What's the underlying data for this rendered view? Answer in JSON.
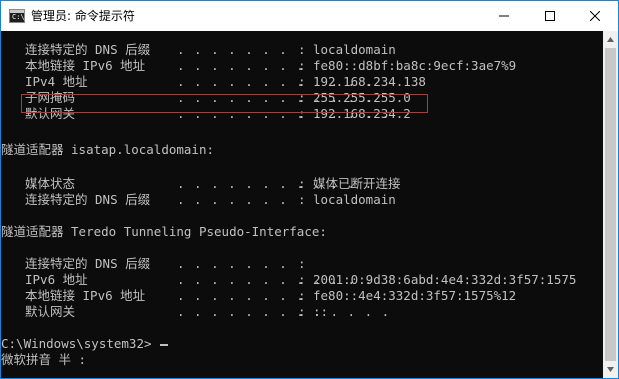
{
  "window": {
    "title": "管理员: 命令提示符",
    "icon": "cmd-icon",
    "icon_prompt": "C:\\",
    "controls": [
      "minimize-icon",
      "maximize-icon",
      "close-icon"
    ]
  },
  "colors": {
    "console_bg": "#0c0c0c",
    "console_text": "#c0c0c0",
    "highlight_border": "#d42b2b",
    "window_border": "#1883d7"
  },
  "console": {
    "lines": [
      {
        "label": "连接特定的 DNS 后缀",
        "dots": ". . . . . . .",
        "colon": ":",
        "value": "localdomain"
      },
      {
        "label": "本地链接 IPv6 地址",
        "dots": ". . . . . . . .",
        "colon": ":",
        "value": "fe80::d8bf:ba8c:9ecf:3ae7%9"
      },
      {
        "label": "IPv4 地址",
        "dots": ". . . . . . . . . . . .",
        "colon": ":",
        "value": "192.168.234.138"
      },
      {
        "label": "子网掩码",
        "dots": ". . . . . . . . . . . .",
        "colon": ":",
        "value": "255.255.255.0"
      },
      {
        "label": "默认网关",
        "dots": ". . . . . . . . . . . . .",
        "colon": ":",
        "value": "192.168.234.2"
      },
      {
        "label": "",
        "dots": "",
        "colon": "",
        "value": ""
      },
      {
        "label": "隧道适配器 isatap.localdomain:",
        "dots": "",
        "colon": "",
        "value": ""
      },
      {
        "label": "",
        "dots": "",
        "colon": "",
        "value": ""
      },
      {
        "label": "媒体状态",
        "dots": ". . . . . . . . . . . .",
        "colon": ":",
        "value": "媒体已断开连接"
      },
      {
        "label": "连接特定的 DNS 后缀",
        "dots": ". . . . . . .",
        "colon": ":",
        "value": "localdomain"
      },
      {
        "label": "",
        "dots": "",
        "colon": "",
        "value": ""
      },
      {
        "label": "隧道适配器 Teredo Tunneling Pseudo-Interface:",
        "dots": "",
        "colon": "",
        "value": ""
      },
      {
        "label": "",
        "dots": "",
        "colon": "",
        "value": ""
      },
      {
        "label": "连接特定的 DNS 后缀",
        "dots": ". . . . . . .",
        "colon": ":",
        "value": ""
      },
      {
        "label": "IPv6 地址",
        "dots": ". . . . . . . . . . . .",
        "colon": ":",
        "value": "2001:0:9d38:6abd:4e4:332d:3f57:1575"
      },
      {
        "label": "本地链接 IPv6 地址",
        "dots": ". . . . . . . .",
        "colon": ":",
        "value": "fe80::4e4:332d:3f57:1575%12"
      },
      {
        "label": "默认网关",
        "dots": ". . . . . . . . . . . . .",
        "colon": ":",
        "value": "::"
      },
      {
        "label": "",
        "dots": "",
        "colon": "",
        "value": ""
      },
      {
        "label": "C:\\Windows\\system32>",
        "dots": "",
        "colon": "",
        "value": ""
      },
      {
        "label": "微软拼音 半 :",
        "dots": "",
        "colon": "",
        "value": ""
      }
    ],
    "highlighted_line": "子网掩码"
  },
  "scrollbar": {
    "up_icon": "scroll-up-arrow-icon",
    "down_icon": "scroll-down-arrow-icon"
  }
}
